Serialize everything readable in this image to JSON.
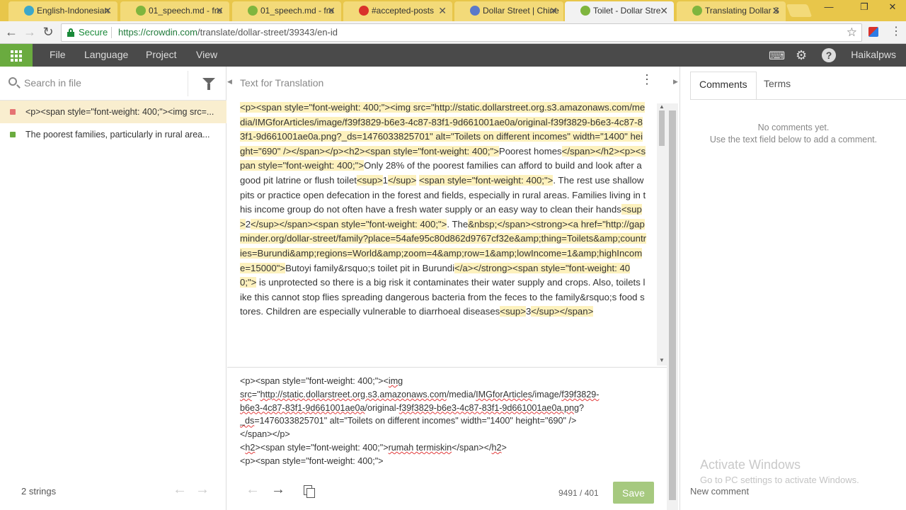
{
  "browser": {
    "tabs": [
      {
        "title": "English-Indonesian",
        "fade": " · ",
        "color": "#3ca7c9"
      },
      {
        "title": "01_speech.md - fro",
        "fade": "",
        "color": "#7fb53e"
      },
      {
        "title": "01_speech.md - fro",
        "fade": "",
        "color": "#7fb53e"
      },
      {
        "title": "#accepted-posts",
        "fade": "",
        "color": "#d9322b"
      },
      {
        "title": "Dollar Street | Chine",
        "fade": "",
        "color": "#5b79c9"
      },
      {
        "title": "Toilet - Dollar Stre",
        "fade": "",
        "color": "#7fb53e"
      },
      {
        "title": "Translating Dollar S",
        "fade": "",
        "color": "#7fb53e"
      }
    ],
    "secure_label": "Secure",
    "url_host": "https://crowdin.com",
    "url_path": "/translate/dollar-street/39343/en-id"
  },
  "appbar": {
    "menus": [
      "File",
      "Language",
      "Project",
      "View"
    ],
    "icons": [
      "keyboard-icon",
      "gear-icon",
      "help-icon"
    ],
    "user": "Haikalpws"
  },
  "left": {
    "search_placeholder": "Search in file",
    "strings": [
      {
        "text": "<p><span style=\"font-weight: 400;\"><img src=...",
        "status_color": "#e57373",
        "selected": true
      },
      {
        "text": "The poorest families, particularly in rural area...",
        "status_color": "#6aab3f",
        "selected": false
      }
    ],
    "count": "2 strings"
  },
  "center": {
    "title": "Text for Translation",
    "source_segments": [
      {
        "t": "<p><span style=\"font-weight: 400;\"><img src=\"http://static.dollarstreet.org.s3.amazonaws.com/media/IMGforArticles/image/f39f3829-b6e3-4c87-83f1-9d661001ae0a/original-f39f3829-b6e3-4c87-83f1-9d661001ae0a.png?_ds=1476033825701\" alt=\"Toilets on different incomes\" width=\"1400\" height=\"690\" /></span></p>",
        "tag": true
      },
      {
        "t": "<h2><span style=\"font-weight: 400;\">",
        "tag": true
      },
      {
        "t": "Poorest homes",
        "tag": false
      },
      {
        "t": "</span></h2>",
        "tag": true
      },
      {
        "t": "<p><span style=\"font-weight: 400;\">",
        "tag": true
      },
      {
        "t": "Only 28% of the poorest families can afford to build and look after a good pit latrine or flush toilet",
        "tag": false
      },
      {
        "t": "<sup>",
        "tag": true
      },
      {
        "t": "1",
        "tag": false
      },
      {
        "t": "</sup>",
        "tag": true
      },
      {
        "t": " ",
        "tag": false
      },
      {
        "t": "<span style=\"font-weight: 400;\">",
        "tag": true
      },
      {
        "t": ". The rest use shallow pits or practice open defecation in the forest and fields, especially in rural areas. Families living in this income group do not often have a fresh water supply or an easy way to clean their hands",
        "tag": false
      },
      {
        "t": "<sup>",
        "tag": true
      },
      {
        "t": "2",
        "tag": false
      },
      {
        "t": "</sup></span><span style=\"font-weight: 400;\">",
        "tag": true
      },
      {
        "t": ". The",
        "tag": false
      },
      {
        "t": "&nbsp;</span><strong><a href=\"http://gapminder.org/dollar-street/family?place=54afe95c80d862d9767cf32e&amp;thing=Toilets&amp;countries=Burundi&amp;regions=World&amp;zoom=4&amp;row=1&amp;lowIncome=1&amp;highIncome=15000\">",
        "tag": true
      },
      {
        "t": "Butoyi family&rsquo;s toilet pit in Burundi",
        "tag": false
      },
      {
        "t": "</a></strong><span style=\"font-weight: 400;\">",
        "tag": true
      },
      {
        "t": " is unprotected so there is a big risk it contaminates their water supply and crops. Also, toilets like this cannot stop flies spreading dangerous bacteria from the feces to the family&rsquo;s food stores. Children are especially vulnerable to diarrhoeal diseases",
        "tag": false
      },
      {
        "t": "<sup>",
        "tag": true
      },
      {
        "t": "3",
        "tag": false
      },
      {
        "t": "</sup></span>",
        "tag": true
      }
    ],
    "translation_lines": [
      [
        {
          "t": "<p><span style=\"font-weight: 400;\"><",
          "sp": false
        },
        {
          "t": "img",
          "sp": true
        }
      ],
      [
        {
          "t": "src",
          "sp": true
        },
        {
          "t": "=\"",
          "sp": false
        },
        {
          "t": "http://static.dollarstreet.org.s3.amazonaws.com",
          "sp": true
        },
        {
          "t": "/media/",
          "sp": false
        },
        {
          "t": "IMGforArticles",
          "sp": true
        },
        {
          "t": "/image/",
          "sp": false
        },
        {
          "t": "f39f3829-",
          "sp": true
        }
      ],
      [
        {
          "t": "b6e3-4c87-83f1-9d661001ae0a",
          "sp": true
        },
        {
          "t": "/original-",
          "sp": false
        },
        {
          "t": "f39f3829-b6e3-4c87-83f1-9d661001ae0a.png",
          "sp": true
        },
        {
          "t": "?",
          "sp": false
        }
      ],
      [
        {
          "t": "_ds",
          "sp": true
        },
        {
          "t": "=1476033825701\" alt=\"Toilets on different incomes\" width=\"1400\" height=\"690\" />",
          "sp": false
        }
      ],
      [
        {
          "t": "</span></p>",
          "sp": false
        }
      ],
      [
        {
          "t": "<",
          "sp": false
        },
        {
          "t": "h2",
          "sp": true
        },
        {
          "t": "><span style=\"font-weight: 400;\">",
          "sp": false
        },
        {
          "t": "rumah termiskin",
          "sp": true
        },
        {
          "t": "</span></",
          "sp": false
        },
        {
          "t": "h2",
          "sp": true
        },
        {
          "t": ">",
          "sp": false
        }
      ],
      [
        {
          "t": "<p><span style=\"font-weight: 400;\">",
          "sp": false
        }
      ]
    ],
    "counter": "9491 / 401",
    "save_label": "Save"
  },
  "right": {
    "tabs": [
      "Comments",
      "Terms"
    ],
    "no_comments": "No comments yet.",
    "hint": "Use the text field below to add a comment.",
    "watermark_title": "Activate Windows",
    "watermark_sub": "Go to PC settings to activate Windows.",
    "new_comment": "New comment"
  }
}
